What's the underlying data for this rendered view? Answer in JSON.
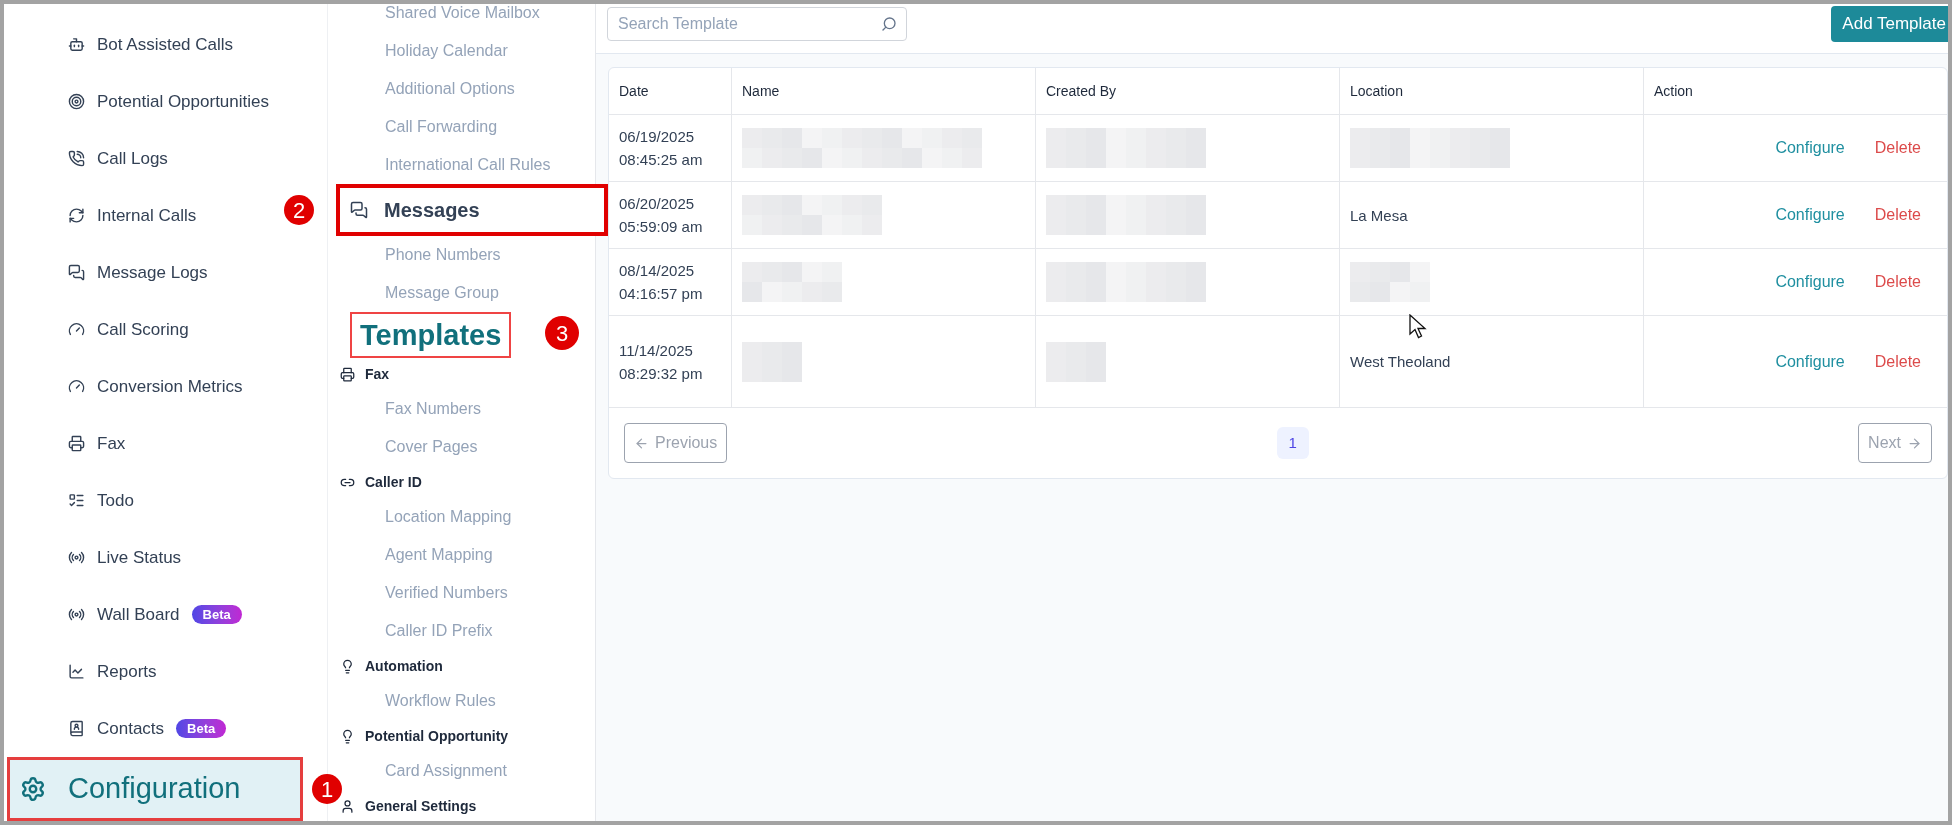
{
  "sidebar": {
    "items": [
      {
        "label": "Bot Assisted Calls",
        "selected": false
      },
      {
        "label": "Potential Opportunities",
        "selected": false
      },
      {
        "label": "Call Logs",
        "selected": false
      },
      {
        "label": "Internal Calls",
        "selected": false
      },
      {
        "label": "Message Logs",
        "selected": false
      },
      {
        "label": "Call Scoring",
        "selected": false
      },
      {
        "label": "Conversion Metrics",
        "selected": false
      },
      {
        "label": "Fax",
        "selected": false
      },
      {
        "label": "Todo",
        "selected": false
      },
      {
        "label": "Live Status",
        "selected": false
      },
      {
        "label": "Wall Board",
        "selected": false,
        "badge": "Beta"
      },
      {
        "label": "Reports",
        "selected": false
      },
      {
        "label": "Contacts",
        "selected": false,
        "badge": "Beta"
      },
      {
        "label": "Configuration",
        "selected": true,
        "marker": "1"
      }
    ]
  },
  "settings_nav": {
    "sections": [
      {
        "items": [
          {
            "label": "Shared Voice Mailbox",
            "selected": false
          },
          {
            "label": "Holiday Calendar",
            "selected": false
          },
          {
            "label": "Additional Options",
            "selected": false
          },
          {
            "label": "Call Forwarding",
            "selected": false
          },
          {
            "label": "International Call Rules",
            "selected": false
          }
        ]
      },
      {
        "title": "Messages",
        "marker": "2",
        "items": [
          {
            "label": "Phone Numbers",
            "selected": false
          },
          {
            "label": "Message Group",
            "selected": false
          },
          {
            "label": "Templates",
            "selected": true,
            "marker": "3"
          }
        ]
      },
      {
        "title": "Fax",
        "items": [
          {
            "label": "Fax Numbers",
            "selected": false
          },
          {
            "label": "Cover Pages",
            "selected": false
          }
        ]
      },
      {
        "title": "Caller ID",
        "items": [
          {
            "label": "Location Mapping",
            "selected": false
          },
          {
            "label": "Agent Mapping",
            "selected": false
          },
          {
            "label": "Verified Numbers",
            "selected": false
          },
          {
            "label": "Caller ID Prefix",
            "selected": false
          }
        ]
      },
      {
        "title": "Automation",
        "items": [
          {
            "label": "Workflow Rules",
            "selected": false
          }
        ]
      },
      {
        "title": "Potential Opportunity",
        "items": [
          {
            "label": "Card Assignment",
            "selected": false
          }
        ]
      },
      {
        "title": "General Settings"
      }
    ]
  },
  "toolbar": {
    "search": {
      "placeholder": "Search Template"
    },
    "add_button": "Add Template"
  },
  "table": {
    "columns": [
      "Date",
      "Name",
      "Created By",
      "Location",
      "Action"
    ],
    "rows": [
      {
        "cells": [
          {
            "kind": "text",
            "text": "06/19/2025 08:45:25 am"
          },
          {
            "kind": "blurred"
          },
          {
            "kind": "blurred"
          },
          {
            "kind": "blurred"
          }
        ],
        "actions": [
          {
            "kind": "configure",
            "label": "Configure"
          },
          {
            "kind": "delete",
            "label": "Delete"
          }
        ]
      },
      {
        "cells": [
          {
            "kind": "text",
            "text": "06/20/2025 05:59:09 am"
          },
          {
            "kind": "blurred"
          },
          {
            "kind": "blurred"
          },
          {
            "kind": "text",
            "text": "La Mesa"
          }
        ],
        "actions": [
          {
            "kind": "configure",
            "label": "Configure"
          },
          {
            "kind": "delete",
            "label": "Delete"
          }
        ]
      },
      {
        "cells": [
          {
            "kind": "text",
            "text": "08/14/2025 04:16:57 pm"
          },
          {
            "kind": "blurred"
          },
          {
            "kind": "blurred"
          },
          {
            "kind": "blurred"
          }
        ],
        "actions": [
          {
            "kind": "configure",
            "label": "Configure"
          },
          {
            "kind": "delete",
            "label": "Delete"
          }
        ]
      },
      {
        "cells": [
          {
            "kind": "text",
            "text": "11/14/2025 08:29:32 pm"
          },
          {
            "kind": "blurred"
          },
          {
            "kind": "blurred"
          },
          {
            "kind": "text",
            "text": "West Theoland"
          }
        ],
        "actions": [
          {
            "kind": "configure",
            "label": "Configure"
          },
          {
            "kind": "delete",
            "label": "Delete"
          }
        ]
      }
    ]
  },
  "pagination": {
    "previous": {
      "label": "Previous",
      "disabled": true
    },
    "pages": [
      {
        "label": "1",
        "selected": true
      }
    ],
    "next": {
      "label": "Next",
      "disabled": true
    }
  }
}
